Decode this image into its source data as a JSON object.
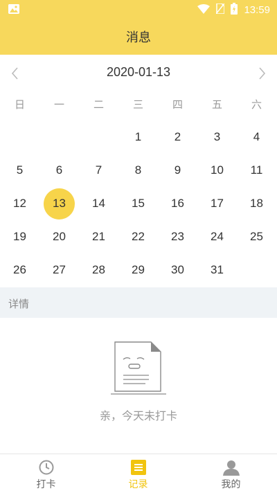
{
  "status_bar": {
    "time": "13:59"
  },
  "header": {
    "title": "消息"
  },
  "calendar": {
    "current_date": "2020-01-13",
    "weekdays": [
      "日",
      "一",
      "二",
      "三",
      "四",
      "五",
      "六"
    ],
    "weeks": [
      [
        "",
        "",
        "",
        "1",
        "2",
        "3",
        "4"
      ],
      [
        "5",
        "6",
        "7",
        "8",
        "9",
        "10",
        "11"
      ],
      [
        "12",
        "13",
        "14",
        "15",
        "16",
        "17",
        "18"
      ],
      [
        "19",
        "20",
        "21",
        "22",
        "23",
        "24",
        "25"
      ],
      [
        "26",
        "27",
        "28",
        "29",
        "30",
        "31",
        ""
      ]
    ],
    "selected_day": "13",
    "selected_color": "#f7d44a"
  },
  "details": {
    "label": "详情",
    "empty_message": "亲，今天未打卡"
  },
  "tabbar": {
    "items": [
      {
        "label": "打卡",
        "icon": "clock-icon",
        "active": false
      },
      {
        "label": "记录",
        "icon": "list-icon",
        "active": true
      },
      {
        "label": "我的",
        "icon": "person-icon",
        "active": false
      }
    ],
    "active_color": "#f1c40f"
  },
  "colors": {
    "header_bg": "#f7d85c",
    "details_bg": "#eff3f6"
  }
}
